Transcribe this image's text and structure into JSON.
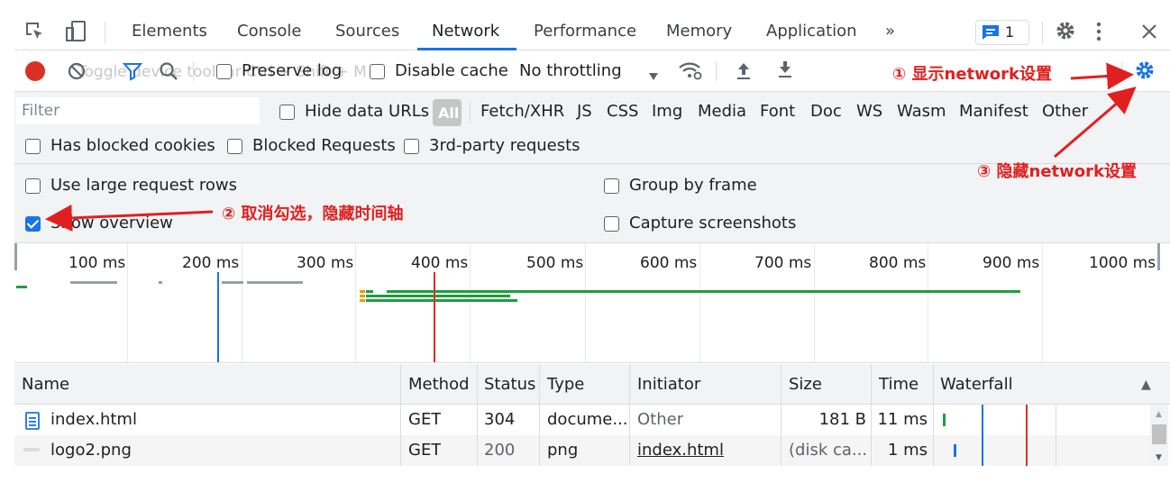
{
  "tabs": [
    "Elements",
    "Console",
    "Sources",
    "Network",
    "Performance",
    "Memory",
    "Application"
  ],
  "more_tabs": "»",
  "issues_count": "1",
  "toolbar": {
    "tooltip_text": "Toggle device toolbar Ctrl + Shift + M",
    "preserve_log": "Preserve log",
    "disable_cache": "Disable cache",
    "throttling": "No throttling"
  },
  "filter": {
    "placeholder": "Filter",
    "hide_data_urls": "Hide data URLs",
    "types": [
      "All",
      "Fetch/XHR",
      "JS",
      "CSS",
      "Img",
      "Media",
      "Font",
      "Doc",
      "WS",
      "Wasm",
      "Manifest",
      "Other"
    ],
    "has_blocked_cookies": "Has blocked cookies",
    "blocked_requests": "Blocked Requests",
    "third_party": "3rd-party requests"
  },
  "settings": {
    "large_rows": "Use large request rows",
    "show_overview": "Show overview",
    "group_by_frame": "Group by frame",
    "capture_screenshots": "Capture screenshots"
  },
  "overview": {
    "ticks": [
      "100 ms",
      "200 ms",
      "300 ms",
      "400 ms",
      "500 ms",
      "600 ms",
      "700 ms",
      "800 ms",
      "900 ms",
      "1000 ms"
    ]
  },
  "annotations": {
    "a1": "① 显示network设置",
    "a2": "② 取消勾选，隐藏时间轴",
    "a3": "③ 隐藏network设置"
  },
  "table": {
    "columns": [
      "Name",
      "Method",
      "Status",
      "Type",
      "Initiator",
      "Size",
      "Time",
      "Waterfall"
    ],
    "sort_indicator": "▲",
    "rows": [
      {
        "name": "index.html",
        "method": "GET",
        "status": "304",
        "type": "docume...",
        "initiator": "Other",
        "size": "181 B",
        "time": "11 ms"
      },
      {
        "name": "logo2.png",
        "method": "GET",
        "status": "200",
        "type": "png",
        "initiator": "index.html",
        "size": "(disk ca...",
        "time": "1 ms"
      }
    ]
  },
  "colors": {
    "accent": "#1a73e8",
    "record": "#d93025",
    "annotation": "#e02020",
    "waterfall_green": "#1e9e3e"
  }
}
